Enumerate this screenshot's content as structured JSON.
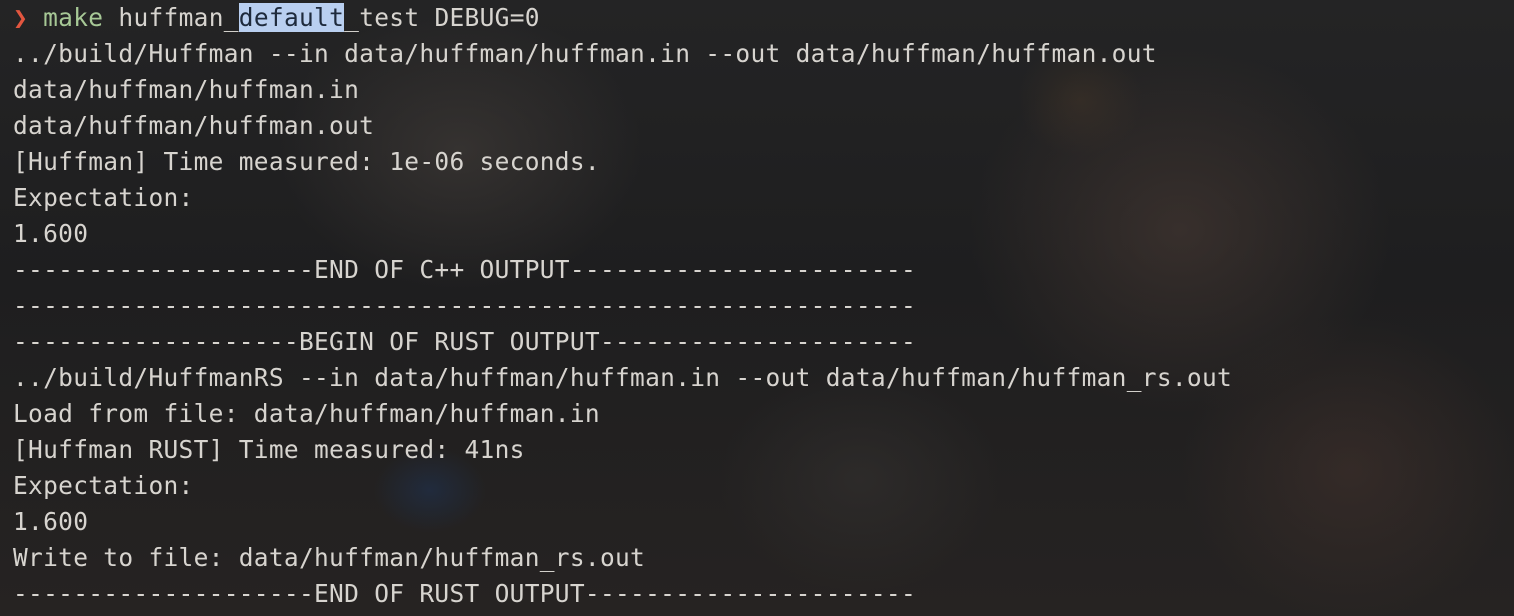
{
  "prompt": {
    "symbol": "❯",
    "command": "make",
    "arg_pre": "huffman_",
    "arg_selected": "default",
    "arg_post": "_test DEBUG=0"
  },
  "output_lines": [
    "../build/Huffman --in data/huffman/huffman.in --out data/huffman/huffman.out",
    "data/huffman/huffman.in",
    "data/huffman/huffman.out",
    "[Huffman] Time measured: 1e-06 seconds.",
    "Expectation:",
    "1.600",
    "--------------------END OF C++ OUTPUT-----------------------",
    "------------------------------------------------------------",
    "-------------------BEGIN OF RUST OUTPUT---------------------",
    "../build/HuffmanRS --in data/huffman/huffman.in --out data/huffman/huffman_rs.out",
    "Load from file: data/huffman/huffman.in",
    "[Huffman RUST] Time measured: 41ns",
    "Expectation:",
    "1.600",
    "Write to file: data/huffman/huffman_rs.out",
    "--------------------END OF RUST OUTPUT----------------------"
  ],
  "colors": {
    "prompt_symbol": "#e2563f",
    "command": "#a7c896",
    "text": "#d7d4cf",
    "selection": "#b9cff0"
  }
}
